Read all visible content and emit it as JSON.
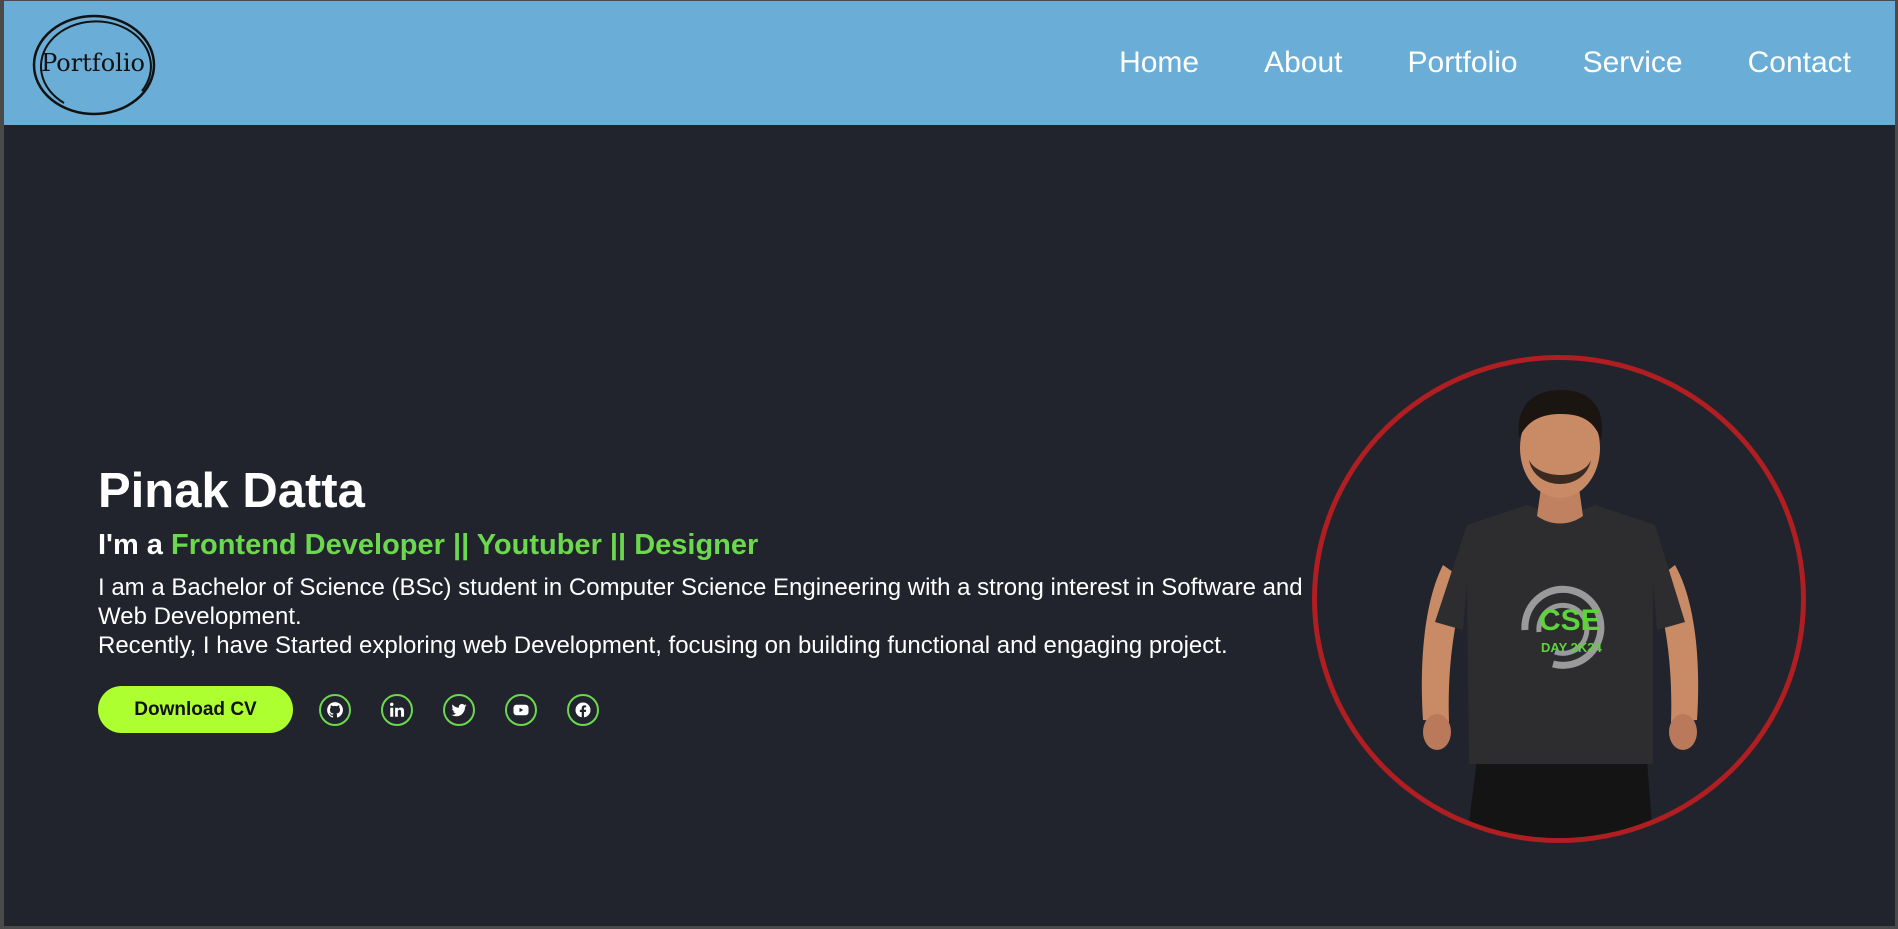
{
  "logo": {
    "text": "Portfolio"
  },
  "nav": {
    "items": [
      {
        "label": "Home"
      },
      {
        "label": "About"
      },
      {
        "label": "Portfolio"
      },
      {
        "label": "Service"
      },
      {
        "label": "Contact"
      }
    ]
  },
  "hero": {
    "name": "Pinak Datta",
    "intro_prefix": "I'm a ",
    "roles": "Frontend Developer || Youtuber || Designer",
    "bio_line1": "I am a Bachelor of Science (BSc) student in Computer Science Engineering with a strong interest in Software and Web Development.",
    "bio_line2": "Recently, I have Started exploring web Development, focusing on building functional and engaging project.",
    "cta_label": "Download CV"
  },
  "socials": [
    "github-icon",
    "linkedin-icon",
    "twitter-icon",
    "youtube-icon",
    "facebook-icon"
  ],
  "photo": {
    "shirt_text": "CSE",
    "shirt_subtext": "DAY 2K24"
  },
  "colors": {
    "navbar": "#6aadd6",
    "background": "#21242c",
    "accent_green": "#6bd84d",
    "button": "#adff2f",
    "photo_ring": "#b01e22"
  }
}
